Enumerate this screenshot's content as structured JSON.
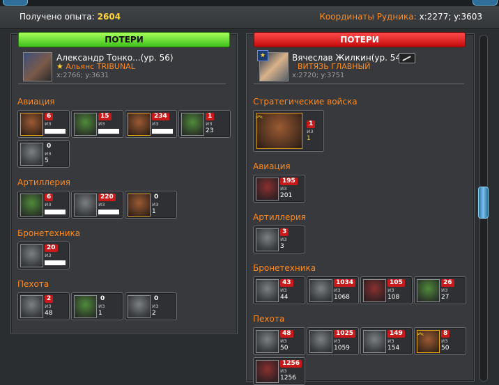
{
  "top": {
    "exp_label": "Получено опыта:",
    "exp_value": "2604",
    "coords_label": "Координаты Рудника:",
    "coords_value": "x:2277; y:3603"
  },
  "left": {
    "header": "ПОТЕРИ",
    "player": {
      "name": "Александр Тонко...(ур. 56)",
      "alliance": "Альянс TRIBUNAL",
      "coords": "x:2766; y:3631"
    },
    "categories": [
      {
        "label": "Авиация",
        "units": [
          {
            "lost": "6",
            "of": "из",
            "total": ""
          },
          {
            "lost": "15",
            "of": "из",
            "total": ""
          },
          {
            "lost": "234",
            "of": "из",
            "total": ""
          },
          {
            "lost": "1",
            "of": "из",
            "total": "23"
          },
          {
            "lost": "0",
            "of": "из",
            "total": "5"
          }
        ]
      },
      {
        "label": "Артиллерия",
        "units": [
          {
            "lost": "6",
            "of": "из",
            "total": ""
          },
          {
            "lost": "220",
            "of": "из",
            "total": ""
          },
          {
            "lost": "0",
            "of": "из",
            "total": "1"
          }
        ]
      },
      {
        "label": "Бронетехника",
        "units": [
          {
            "lost": "20",
            "of": "из",
            "total": ""
          }
        ]
      },
      {
        "label": "Пехота",
        "units": [
          {
            "lost": "2",
            "of": "из",
            "total": "48"
          },
          {
            "lost": "0",
            "of": "из",
            "total": "1"
          },
          {
            "lost": "0",
            "of": "из",
            "total": "2"
          }
        ]
      }
    ]
  },
  "right": {
    "header": "ПОТЕРИ",
    "player": {
      "name": "Вячеслав Жилкин(ур. 54)",
      "title": "ВИТЯЗЬ ГЛАВНЫЙ",
      "coords": "x:2720; y:3751"
    },
    "categories": [
      {
        "label": "Стратегические войска",
        "units": [
          {
            "lost": "1",
            "of": "из",
            "total": "1"
          }
        ]
      },
      {
        "label": "Авиация",
        "units": [
          {
            "lost": "195",
            "of": "из",
            "total": "201"
          }
        ]
      },
      {
        "label": "Артиллерия",
        "units": [
          {
            "lost": "3",
            "of": "из",
            "total": "3"
          }
        ]
      },
      {
        "label": "Бронетехника",
        "units": [
          {
            "lost": "43",
            "of": "из",
            "total": "44"
          },
          {
            "lost": "1034",
            "of": "из",
            "total": "1068"
          },
          {
            "lost": "105",
            "of": "из",
            "total": "108"
          },
          {
            "lost": "26",
            "of": "из",
            "total": "27"
          }
        ]
      },
      {
        "label": "Пехота",
        "units": [
          {
            "lost": "48",
            "of": "из",
            "total": "50"
          },
          {
            "lost": "1025",
            "of": "из",
            "total": "1059"
          },
          {
            "lost": "149",
            "of": "из",
            "total": "154"
          },
          {
            "lost": "8",
            "of": "из",
            "total": "50"
          },
          {
            "lost": "1256",
            "of": "из",
            "total": "1256"
          }
        ]
      }
    ]
  }
}
